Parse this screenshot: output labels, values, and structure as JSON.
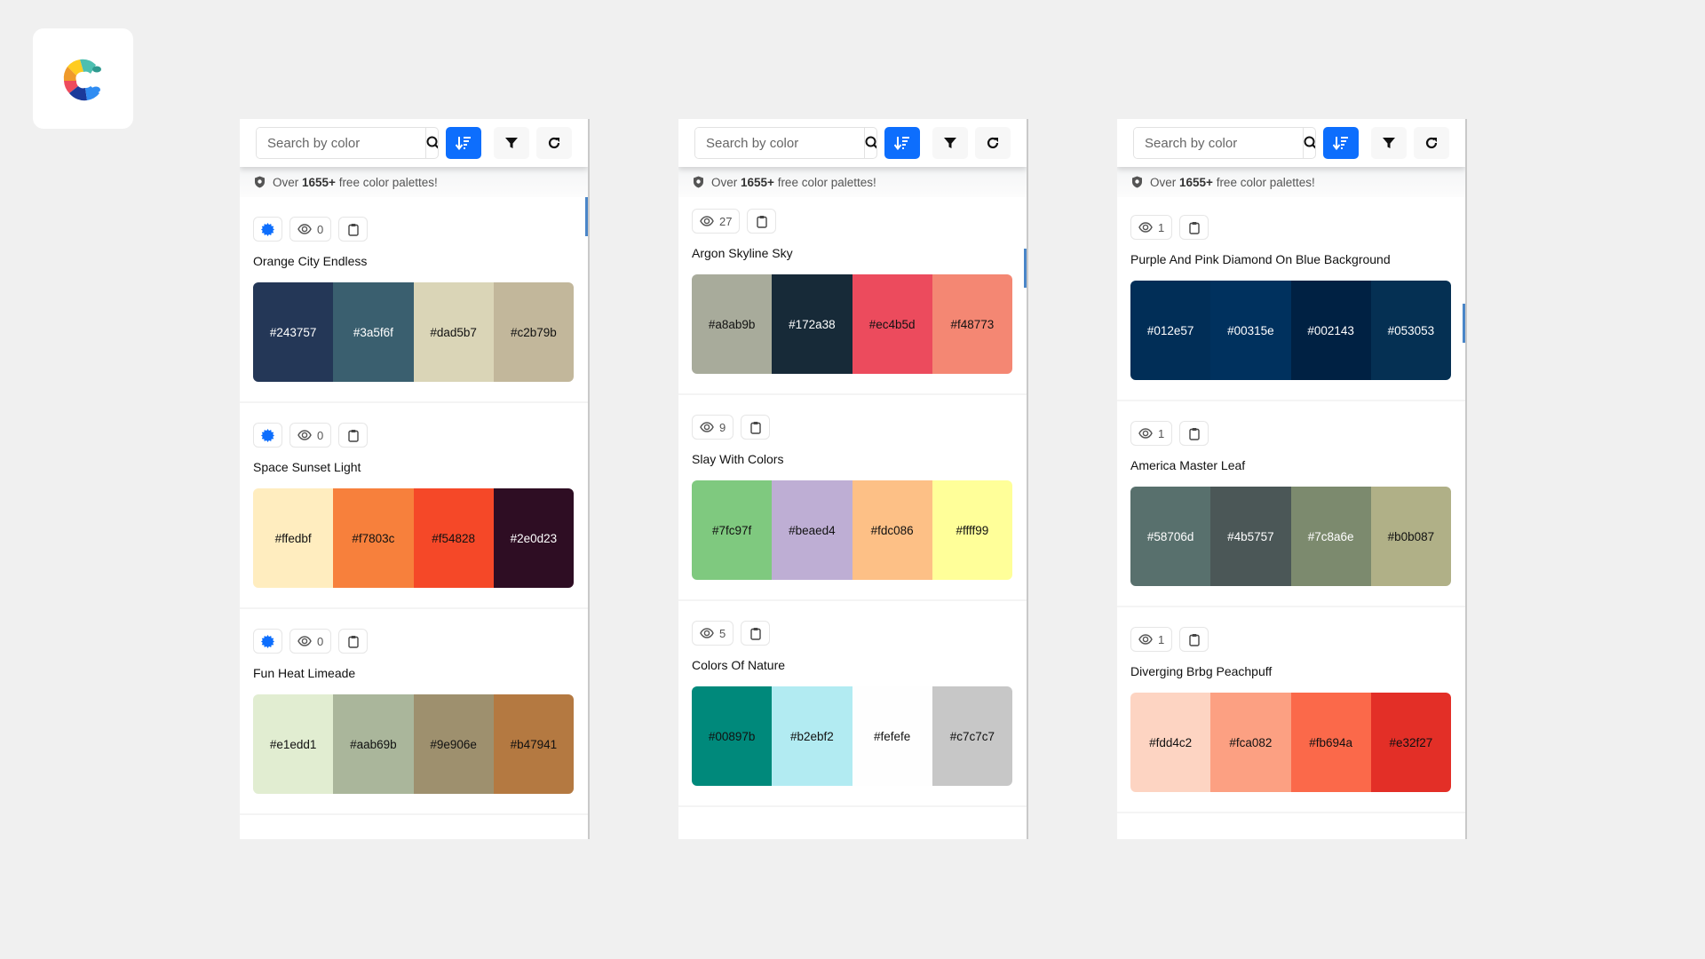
{
  "app": {
    "logo_icon": "colorffy-c-logo"
  },
  "panels": [
    {
      "toolbar": {
        "search_placeholder": "Search by color",
        "search_icon": "search-icon",
        "sort_icon": "sort-descending-icon",
        "filter_icon": "filter-icon",
        "refresh_icon": "refresh-icon"
      },
      "banner": {
        "prefix": "Over ",
        "count": "1655+",
        "suffix": " free color palettes!"
      },
      "palettes": [
        {
          "name": "Orange City Endless",
          "views": "0",
          "badge": true,
          "colors": [
            "#243757",
            "#3a5f6f",
            "#dad5b7",
            "#c2b79b"
          ],
          "text_colors": [
            "#ffffff",
            "#ffffff",
            "#111111",
            "#111111"
          ]
        },
        {
          "name": "Space Sunset Light",
          "views": "0",
          "badge": true,
          "colors": [
            "#ffedbf",
            "#f7803c",
            "#f54828",
            "#2e0d23"
          ],
          "text_colors": [
            "#111111",
            "#111111",
            "#111111",
            "#ffffff"
          ]
        },
        {
          "name": "Fun Heat Limeade",
          "views": "0",
          "badge": true,
          "colors": [
            "#e1edd1",
            "#aab69b",
            "#9e906e",
            "#b47941"
          ],
          "text_colors": [
            "#111111",
            "#111111",
            "#111111",
            "#111111"
          ]
        }
      ]
    },
    {
      "toolbar": {
        "search_placeholder": "Search by color",
        "search_icon": "search-icon",
        "sort_icon": "sort-descending-icon",
        "filter_icon": "filter-icon",
        "refresh_icon": "refresh-icon"
      },
      "banner": {
        "prefix": "Over ",
        "count": "1655+",
        "suffix": " free color palettes!"
      },
      "palettes": [
        {
          "name": "Argon Skyline Sky",
          "views": "27",
          "badge": false,
          "colors": [
            "#a8ab9b",
            "#172a38",
            "#ec4b5d",
            "#f48773"
          ],
          "text_colors": [
            "#111111",
            "#ffffff",
            "#111111",
            "#111111"
          ]
        },
        {
          "name": "Slay With Colors",
          "views": "9",
          "badge": false,
          "colors": [
            "#7fc97f",
            "#beaed4",
            "#fdc086",
            "#ffff99"
          ],
          "text_colors": [
            "#111111",
            "#111111",
            "#111111",
            "#111111"
          ]
        },
        {
          "name": "Colors Of Nature",
          "views": "5",
          "badge": false,
          "colors": [
            "#00897b",
            "#b2ebf2",
            "#fefefe",
            "#c7c7c7"
          ],
          "text_colors": [
            "#111111",
            "#111111",
            "#111111",
            "#111111"
          ]
        }
      ]
    },
    {
      "toolbar": {
        "search_placeholder": "Search by color",
        "search_icon": "search-icon",
        "sort_icon": "sort-descending-icon",
        "filter_icon": "filter-icon",
        "refresh_icon": "refresh-icon"
      },
      "banner": {
        "prefix": "Over ",
        "count": "1655+",
        "suffix": " free color palettes!"
      },
      "palettes": [
        {
          "name": "Purple And Pink Diamond On Blue Background",
          "views": "1",
          "badge": false,
          "colors": [
            "#012e57",
            "#00315e",
            "#002143",
            "#053053"
          ],
          "text_colors": [
            "#ffffff",
            "#ffffff",
            "#ffffff",
            "#ffffff"
          ]
        },
        {
          "name": "America Master Leaf",
          "views": "1",
          "badge": false,
          "colors": [
            "#58706d",
            "#4b5757",
            "#7c8a6e",
            "#b0b087"
          ],
          "text_colors": [
            "#ffffff",
            "#ffffff",
            "#ffffff",
            "#111111"
          ]
        },
        {
          "name": "Diverging Brbg Peachpuff",
          "views": "1",
          "badge": false,
          "colors": [
            "#fdd4c2",
            "#fca082",
            "#fb694a",
            "#e32f27"
          ],
          "text_colors": [
            "#111111",
            "#111111",
            "#111111",
            "#111111"
          ]
        }
      ]
    }
  ],
  "theme": {
    "accent": "#0d6efd",
    "badge_color": "#0d6efd",
    "page_bg": "#f0f0f0"
  }
}
